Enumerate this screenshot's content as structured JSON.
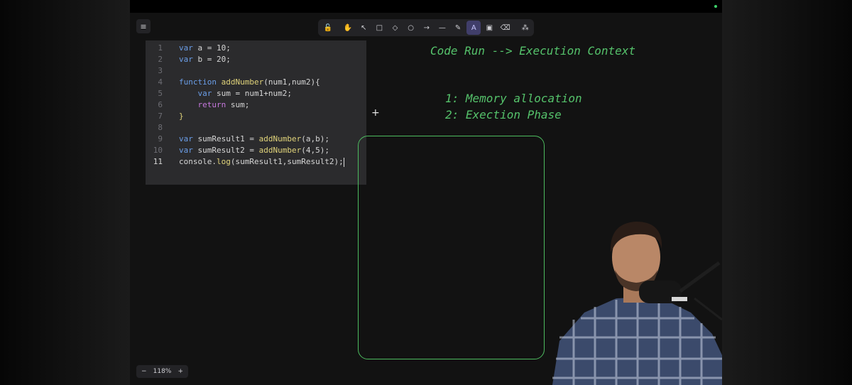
{
  "menu": {
    "icon": "≡"
  },
  "toolbar": {
    "tools": [
      {
        "name": "lock",
        "glyph": "🔓"
      },
      {
        "name": "hand",
        "glyph": "✋"
      },
      {
        "name": "select",
        "glyph": "↖"
      },
      {
        "name": "rectangle",
        "glyph": "□"
      },
      {
        "name": "diamond",
        "glyph": "◇"
      },
      {
        "name": "ellipse",
        "glyph": "○"
      },
      {
        "name": "arrow",
        "glyph": "→"
      },
      {
        "name": "line",
        "glyph": "—"
      },
      {
        "name": "draw",
        "glyph": "✎"
      },
      {
        "name": "text",
        "glyph": "A"
      },
      {
        "name": "image",
        "glyph": "▣"
      },
      {
        "name": "eraser",
        "glyph": "⌫"
      },
      {
        "name": "library",
        "glyph": "⁂"
      }
    ],
    "active": "text"
  },
  "code": {
    "lines": [
      {
        "n": "1"
      },
      {
        "n": "2"
      },
      {
        "n": "3"
      },
      {
        "n": "4"
      },
      {
        "n": "5"
      },
      {
        "n": "6"
      },
      {
        "n": "7"
      },
      {
        "n": "8"
      },
      {
        "n": "9"
      },
      {
        "n": "10"
      },
      {
        "n": "11"
      }
    ]
  },
  "canvas": {
    "heading": "Code Run --> Execution Context",
    "step1": "1: Memory allocation",
    "step2": "2: Exection Phase",
    "plus": "+"
  },
  "zoom": {
    "minus": "−",
    "level": "118%",
    "plus": "+"
  },
  "colors": {
    "accent_green": "#4dbb5f",
    "active_tool": "#403e6a"
  }
}
